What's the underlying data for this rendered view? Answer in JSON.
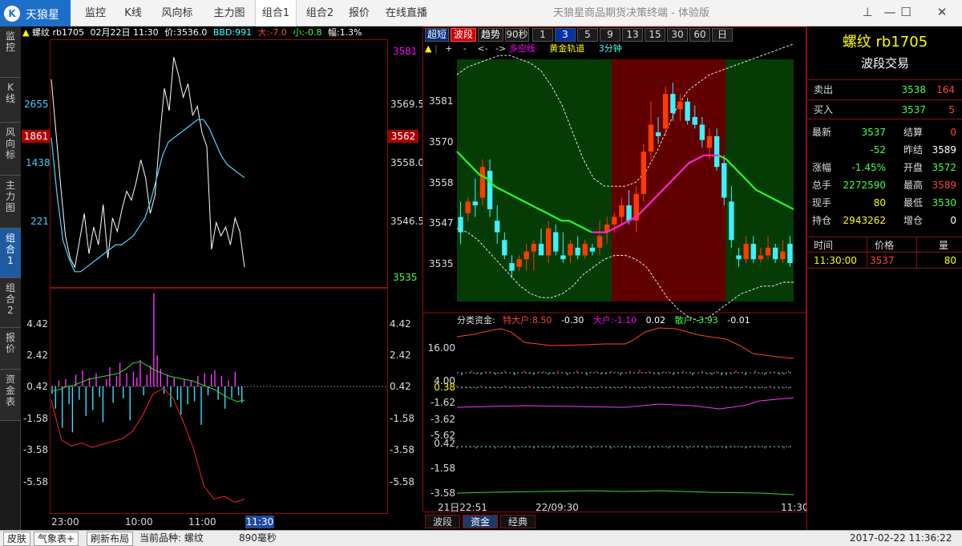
{
  "titlebar": {
    "logo_text": "天狼星",
    "nav": [
      "监控",
      "K线",
      "风向标",
      "主力图",
      "组合1",
      "组合2",
      "报价",
      "在线直播"
    ],
    "active_nav": 4,
    "app_title": "天狼星商品期货决策终端 - 体验版",
    "min_glyph": "—",
    "max_glyph": "☐",
    "close_glyph": "✕",
    "pin_glyph": "⊥"
  },
  "vtabs": [
    "监控",
    "K线",
    "风向标",
    "主力图",
    "组合1",
    "组合2",
    "报价",
    "资金表"
  ],
  "active_vtab": 4,
  "left_chart": {
    "header": {
      "name": "螺纹",
      "code": "rb1705",
      "date": "02月22日",
      "time": "11:30",
      "price": "价:3536.0",
      "bbd": "BBD:991",
      "big": "大:-7.0",
      "small": "小:-0.8",
      "amp": "幅:1.3%"
    },
    "left_axis": [
      "2655",
      "1438",
      "221"
    ],
    "left_axis_marker": "1861",
    "right_axis": [
      "3581",
      "3569.5",
      "3558.0",
      "3546.5",
      "3535"
    ],
    "right_axis_marker": "3562",
    "price_series": [
      3578,
      3566,
      3554,
      3543,
      3538,
      3536,
      3542,
      3548,
      3539,
      3545,
      3541,
      3550,
      3538,
      3547,
      3544,
      3549,
      3553,
      3551,
      3555,
      3560,
      3556,
      3548,
      3552,
      3565,
      3576,
      3571,
      3583,
      3579,
      3574,
      3577,
      3570,
      3572,
      3566,
      3563,
      3540,
      3546,
      3543,
      3545,
      3541,
      3547,
      3544,
      3536
    ],
    "avg_series": [
      3565,
      3552,
      3542,
      3538,
      3535,
      3535,
      3536,
      3537,
      3538,
      3539,
      3540,
      3541,
      3541,
      3542,
      3543,
      3545,
      3547,
      3551,
      3556,
      3561,
      3564,
      3565,
      3566,
      3567,
      3568,
      3569,
      3569,
      3567,
      3564,
      3561,
      3559,
      3558,
      3557,
      3556
    ]
  },
  "left_sub": {
    "axis": [
      "4.42",
      "2.42",
      "0.42",
      "-1.58",
      "-3.58",
      "-5.58"
    ],
    "bars": [
      -0.5,
      -1.5,
      0.4,
      -2.8,
      0.5,
      -1.2,
      -3.1,
      0.8,
      -0.9,
      1.1,
      -2.0,
      0.6,
      -1.6,
      0.9,
      -0.7,
      -2.4,
      0.5,
      1.3,
      -1.1,
      0.7,
      1.6,
      -0.8,
      0.9,
      -2.3,
      1.0,
      0.6,
      1.8,
      -0.6,
      0.8,
      1.4,
      6.3,
      2.1,
      1.2,
      -0.5,
      0.8,
      -1.4,
      0.6,
      -0.9,
      -1.9,
      0.5,
      -1.2,
      0.4,
      -1.0,
      0.7,
      -2.6,
      0.9,
      -0.6,
      0.8,
      1.1,
      -0.9,
      0.7,
      -1.5,
      0.4,
      -0.8,
      1.0,
      -0.6,
      -1.1
    ],
    "green_line": [
      0.1,
      0.2,
      0.4,
      0.5,
      0.7,
      0.9,
      1.0,
      1.1,
      1.2,
      1.3,
      1.6,
      2.0,
      2.1,
      1.8,
      1.5,
      1.3,
      1.1,
      1.0,
      0.9,
      0.8,
      0.6,
      0.4,
      0.2,
      -0.1,
      -0.4,
      -0.6,
      -0.5
    ],
    "red_line": [
      -0.5,
      -3.2,
      -3.6,
      -3.4,
      -3.7,
      -3.5,
      -3.3,
      -3.1,
      -2.6,
      -1.5,
      -0.1,
      0.3,
      -0.4,
      -2.0,
      -3.8,
      -6.3,
      -7.2,
      -7.0,
      -7.4,
      -7.2
    ]
  },
  "time_axis": [
    "23:00",
    "10:00",
    "11:00"
  ],
  "time_marker": "11:30",
  "period_buttons": [
    "超短",
    "波段",
    "趋势",
    "90秒",
    "1",
    "3",
    "5",
    "9",
    "13",
    "15",
    "30",
    "60",
    "日"
  ],
  "kline": {
    "subheader": [
      "▲",
      "|",
      "+",
      "-",
      "<-",
      "->",
      "多空线",
      "黄金轨道",
      "3分钟"
    ],
    "axis": [
      "3581",
      "3570",
      "3558",
      "3547",
      "3535"
    ],
    "band_colors": [
      "#053c05",
      "#600000",
      "#053c05"
    ],
    "candles": [
      {
        "o": 3548,
        "h": 3552,
        "l": 3541,
        "c": 3544
      },
      {
        "o": 3549,
        "h": 3553,
        "l": 3547,
        "c": 3552
      },
      {
        "o": 3552,
        "h": 3558,
        "l": 3548,
        "c": 3551
      },
      {
        "o": 3553,
        "h": 3563,
        "l": 3551,
        "c": 3561
      },
      {
        "o": 3560,
        "h": 3563,
        "l": 3548,
        "c": 3550
      },
      {
        "o": 3547,
        "h": 3551,
        "l": 3541,
        "c": 3544
      },
      {
        "o": 3542,
        "h": 3544,
        "l": 3537,
        "c": 3538
      },
      {
        "o": 3536,
        "h": 3538,
        "l": 3532,
        "c": 3534
      },
      {
        "o": 3535,
        "h": 3538,
        "l": 3534,
        "c": 3537
      },
      {
        "o": 3537,
        "h": 3541,
        "l": 3534,
        "c": 3539
      },
      {
        "o": 3539,
        "h": 3542,
        "l": 3534,
        "c": 3541
      },
      {
        "o": 3541,
        "h": 3545,
        "l": 3538,
        "c": 3538
      },
      {
        "o": 3538,
        "h": 3547,
        "l": 3536,
        "c": 3545
      },
      {
        "o": 3544,
        "h": 3546,
        "l": 3538,
        "c": 3539
      },
      {
        "o": 3538,
        "h": 3544,
        "l": 3536,
        "c": 3537
      },
      {
        "o": 3538,
        "h": 3542,
        "l": 3536,
        "c": 3541
      },
      {
        "o": 3540,
        "h": 3543,
        "l": 3537,
        "c": 3538
      },
      {
        "o": 3538,
        "h": 3542,
        "l": 3537,
        "c": 3541
      },
      {
        "o": 3540,
        "h": 3541,
        "l": 3538,
        "c": 3539
      },
      {
        "o": 3540,
        "h": 3547,
        "l": 3538,
        "c": 3543
      },
      {
        "o": 3544,
        "h": 3548,
        "l": 3541,
        "c": 3546
      },
      {
        "o": 3546,
        "h": 3549,
        "l": 3544,
        "c": 3548
      },
      {
        "o": 3548,
        "h": 3553,
        "l": 3546,
        "c": 3551
      },
      {
        "o": 3551,
        "h": 3555,
        "l": 3546,
        "c": 3547
      },
      {
        "o": 3547,
        "h": 3556,
        "l": 3544,
        "c": 3554
      },
      {
        "o": 3554,
        "h": 3567,
        "l": 3552,
        "c": 3565
      },
      {
        "o": 3565,
        "h": 3578,
        "l": 3563,
        "c": 3572
      },
      {
        "o": 3570,
        "h": 3574,
        "l": 3567,
        "c": 3569
      },
      {
        "o": 3571,
        "h": 3582,
        "l": 3569,
        "c": 3580
      },
      {
        "o": 3580,
        "h": 3583,
        "l": 3573,
        "c": 3575
      },
      {
        "o": 3576,
        "h": 3580,
        "l": 3573,
        "c": 3578
      },
      {
        "o": 3578,
        "h": 3579,
        "l": 3572,
        "c": 3573
      },
      {
        "o": 3574,
        "h": 3577,
        "l": 3571,
        "c": 3572
      },
      {
        "o": 3572,
        "h": 3574,
        "l": 3566,
        "c": 3568
      },
      {
        "o": 3566,
        "h": 3571,
        "l": 3563,
        "c": 3569
      },
      {
        "o": 3569,
        "h": 3571,
        "l": 3560,
        "c": 3561
      },
      {
        "o": 3562,
        "h": 3564,
        "l": 3551,
        "c": 3553
      },
      {
        "o": 3552,
        "h": 3556,
        "l": 3540,
        "c": 3542
      },
      {
        "o": 3538,
        "h": 3540,
        "l": 3535,
        "c": 3537
      },
      {
        "o": 3537,
        "h": 3543,
        "l": 3536,
        "c": 3541
      },
      {
        "o": 3541,
        "h": 3543,
        "l": 3536,
        "c": 3537
      },
      {
        "o": 3537,
        "h": 3540,
        "l": 3536,
        "c": 3538
      },
      {
        "o": 3538,
        "h": 3543,
        "l": 3537,
        "c": 3540
      },
      {
        "o": 3540,
        "h": 3541,
        "l": 3536,
        "c": 3537
      },
      {
        "o": 3537,
        "h": 3542,
        "l": 3536,
        "c": 3539
      },
      {
        "o": 3541,
        "h": 3543,
        "l": 3535,
        "c": 3536
      }
    ],
    "ma_series": [
      3565,
      3563,
      3561,
      3559,
      3558,
      3556,
      3555,
      3554,
      3553,
      3552,
      3551,
      3550,
      3549,
      3548,
      3547,
      3547,
      3546,
      3545,
      3544,
      3544,
      3544,
      3545,
      3546,
      3547,
      3548,
      3550,
      3552,
      3554,
      3556,
      3558,
      3560,
      3562,
      3563,
      3564,
      3564,
      3564,
      3563,
      3561,
      3559,
      3557,
      3555,
      3554,
      3553,
      3552,
      3551,
      3550
    ],
    "upper_band": [
      3585,
      3587,
      3588,
      3589,
      3590,
      3590,
      3589,
      3588,
      3586,
      3582,
      3577,
      3570,
      3563,
      3558,
      3556,
      3556,
      3556,
      3557,
      3560,
      3565,
      3571,
      3577,
      3581,
      3583,
      3585,
      3586,
      3587,
      3588,
      3589,
      3590,
      3591,
      3592,
      3593
    ],
    "lower_band": [
      3545,
      3544,
      3542,
      3539,
      3536,
      3533,
      3530,
      3528,
      3527,
      3527,
      3528,
      3530,
      3533,
      3535,
      3537,
      3538,
      3538,
      3537,
      3535,
      3531,
      3527,
      3524,
      3522,
      3521,
      3522,
      3524,
      3526,
      3528,
      3529,
      3530,
      3530,
      3531,
      3531
    ]
  },
  "fund": {
    "header": {
      "label": "分类资金:",
      "special_label": "特大户:",
      "special_val": "8.50",
      "special_chg": "-0.30",
      "big_label": "大户:",
      "big_val": "-1.10",
      "big_chg": "0.02",
      "retail_label": "散户:",
      "retail_val": "-3.93",
      "retail_chg": "-0.01"
    },
    "axis_top": [
      "16.00",
      "4.00"
    ],
    "axis_mid": [
      "0.38",
      "-1.62",
      "-3.62",
      "-5.62"
    ],
    "axis_bot": [
      "0.42",
      "-1.58",
      "-3.58"
    ]
  },
  "bottom_time_axis": [
    "21日22:51",
    "22/09:30",
    "11:30"
  ],
  "bottom_tabs": [
    "波段",
    "资金",
    "经典"
  ],
  "active_bottom_tab": 1,
  "quote": {
    "title": "螺纹 rb1705",
    "subtitle": "波段交易",
    "sell_label": "卖出",
    "sell_price": "3538",
    "sell_vol": "164",
    "buy_label": "买入",
    "buy_price": "3537",
    "buy_vol": "5",
    "rows": [
      {
        "l1": "最新",
        "v1": "3537",
        "l2": "结算",
        "v2": "0"
      },
      {
        "l1": "",
        "v1": "-52",
        "l2": "昨结",
        "v2": "3589"
      },
      {
        "l1": "涨幅",
        "v1": "-1.45%",
        "l2": "开盘",
        "v2": "3572"
      },
      {
        "l1": "总手",
        "v1": "2272590",
        "l2": "最高",
        "v2": "3589"
      },
      {
        "l1": "现手",
        "v1": "80",
        "l2": "最低",
        "v2": "3530"
      },
      {
        "l1": "持仓",
        "v1": "2943262",
        "l2": "增仓",
        "v2": "0"
      }
    ],
    "tick_header": [
      "时间",
      "价格",
      "量"
    ],
    "tick_row": [
      "11:30:00",
      "3537",
      "80"
    ]
  },
  "statusbar": {
    "skin": "皮肤",
    "weather": "气象表+",
    "refresh": "刷新布局",
    "current": "当前品种: 螺纹",
    "latency": "890毫秒",
    "datetime": "2017-02-22  11:36:22"
  }
}
